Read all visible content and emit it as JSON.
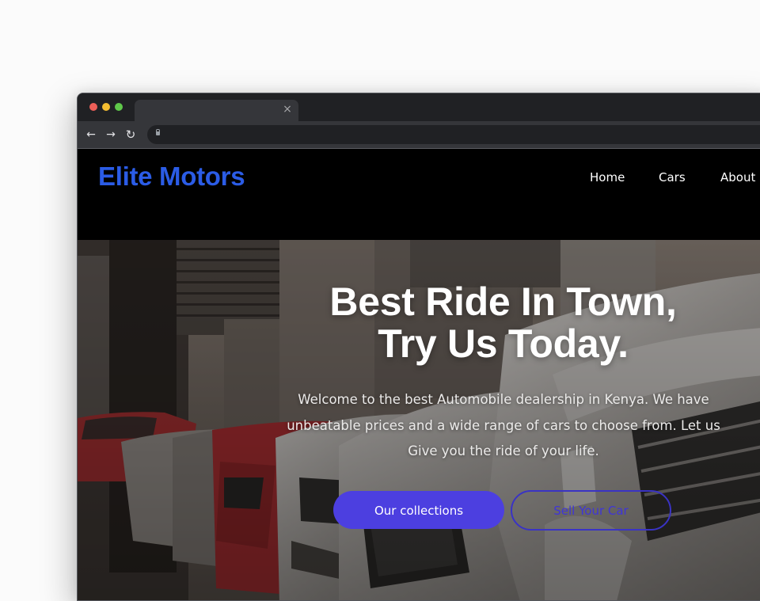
{
  "browser": {
    "tab_close_glyph": "×",
    "back_glyph": "←",
    "forward_glyph": "→",
    "reload_glyph": "↻"
  },
  "site": {
    "logo": "Elite Motors",
    "nav": {
      "home": "Home",
      "cars": "Cars",
      "about": "About"
    }
  },
  "hero": {
    "title_line1": "Best Ride In Town,",
    "title_line2": "Try Us Today.",
    "description": "Welcome to the best Automobile dealership in Kenya. We have unbeatable prices and a wide range of cars to choose from. Let us Give you the ride of your life.",
    "primary_button": "Our collections",
    "secondary_button": "Sell Your Car"
  },
  "colors": {
    "brand": "#2b5ce6",
    "primary_button": "#4c3fe0",
    "outline_button": "#3a33c4",
    "header_bg": "#000000"
  }
}
